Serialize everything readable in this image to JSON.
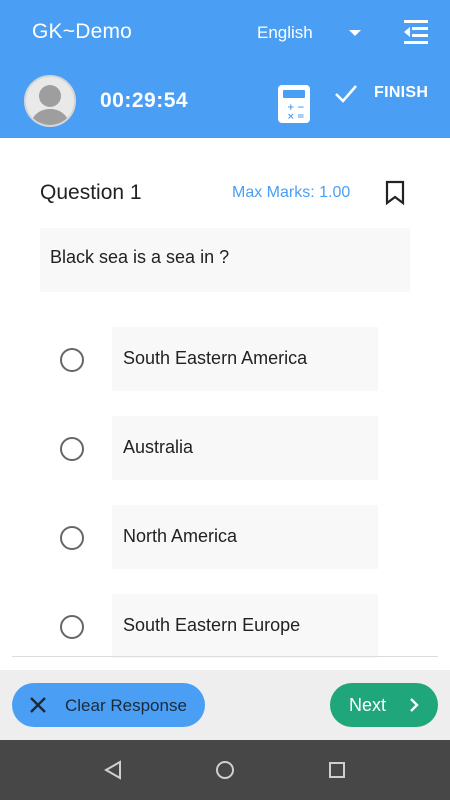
{
  "header": {
    "app_title": "GK~Demo",
    "language": "English",
    "timer": "00:29:54",
    "finish_label": "FINISH",
    "background_color": "#4A9FF5",
    "icons": [
      "menu-collapse-icon",
      "calculator-icon",
      "check-icon",
      "avatar-icon",
      "chevron-down-icon"
    ]
  },
  "question": {
    "title": "Question 1",
    "max_marks": "Max Marks: 1.00",
    "text": "Black sea is a sea in ?",
    "bookmark_icon": "bookmark-icon"
  },
  "options": [
    {
      "label": "South Eastern America",
      "selected": false
    },
    {
      "label": "Australia",
      "selected": false
    },
    {
      "label": "North America",
      "selected": false
    },
    {
      "label": "South Eastern Europe",
      "selected": false
    }
  ],
  "footer": {
    "clear_label": "Clear Response",
    "next_label": "Next",
    "clear_color": "#4A9FF5",
    "next_color": "#1FA67A"
  },
  "navbar": {
    "icons": [
      "back-icon",
      "home-icon",
      "recents-icon"
    ]
  }
}
